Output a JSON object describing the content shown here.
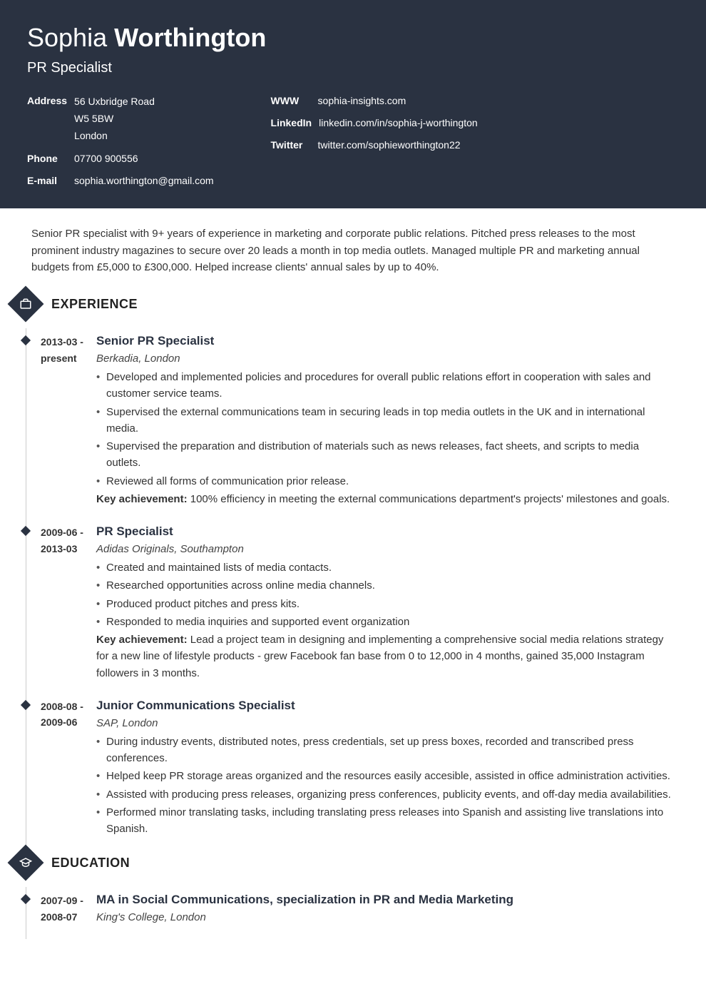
{
  "header": {
    "first_name": "Sophia",
    "last_name": "Worthington",
    "title": "PR Specialist",
    "contact_left": [
      {
        "label": "Address",
        "value": "56 Uxbridge Road\nW5 5BW\nLondon"
      },
      {
        "label": "Phone",
        "value": "07700 900556"
      },
      {
        "label": "E-mail",
        "value": "sophia.worthington@gmail.com"
      }
    ],
    "contact_right": [
      {
        "label": "WWW",
        "value": "sophia-insights.com"
      },
      {
        "label": "LinkedIn",
        "value": "linkedin.com/in/sophia-j-worthington"
      },
      {
        "label": "Twitter",
        "value": "twitter.com/sophieworthington22"
      }
    ]
  },
  "summary": "Senior PR specialist with 9+ years of experience in marketing and corporate public relations. Pitched press releases to the most prominent industry magazines to secure over 20 leads a month in top media outlets. Managed multiple PR and marketing annual budgets from £5,000 to £300,000. Helped increase clients' annual sales by up to 40%.",
  "sections": {
    "experience": {
      "title": "EXPERIENCE",
      "entries": [
        {
          "dates": "2013-03 - present",
          "title": "Senior PR Specialist",
          "sub": "Berkadia, London",
          "bullets": [
            "Developed and implemented policies and procedures for overall public relations effort in cooperation with sales and customer service teams.",
            "Supervised the external communications team in securing leads in top media outlets in the UK and in international media.",
            "Supervised the preparation and distribution of materials such as news releases, fact sheets, and scripts to media outlets.",
            "Reviewed all forms of communication prior release."
          ],
          "key_label": "Key achievement:",
          "key_text": " 100% efficiency in meeting the external communications department's projects' milestones and goals."
        },
        {
          "dates": "2009-06 - 2013-03",
          "title": "PR Specialist",
          "sub": "Adidas Originals, Southampton",
          "bullets": [
            "Created and maintained lists of media contacts.",
            "Researched opportunities across online media channels.",
            "Produced product pitches and press kits.",
            "Responded to media inquiries and supported event organization"
          ],
          "key_label": "Key achievement:",
          "key_text": " Lead a project team in designing and implementing a comprehensive social media relations strategy for a new line of lifestyle products - grew Facebook fan base from 0 to 12,000 in 4 months, gained 35,000 Instagram followers in 3 months."
        },
        {
          "dates": "2008-08 - 2009-06",
          "title": "Junior Communications Specialist",
          "sub": "SAP, London",
          "bullets": [
            "During industry events, distributed notes, press credentials, set up press boxes, recorded and transcribed press conferences.",
            "Helped keep PR storage areas organized and the resources easily accesible, assisted in office administration activities.",
            "Assisted with producing press releases, organizing press conferences, publicity events, and off-day media availabilities.",
            "Performed minor translating tasks, including translating press releases into Spanish and assisting live translations into Spanish."
          ]
        }
      ]
    },
    "education": {
      "title": "EDUCATION",
      "entries": [
        {
          "dates": "2007-09 - 2008-07",
          "title": "MA in Social Communications, specialization in PR and Media Marketing",
          "sub": "King's College, London"
        }
      ]
    }
  }
}
